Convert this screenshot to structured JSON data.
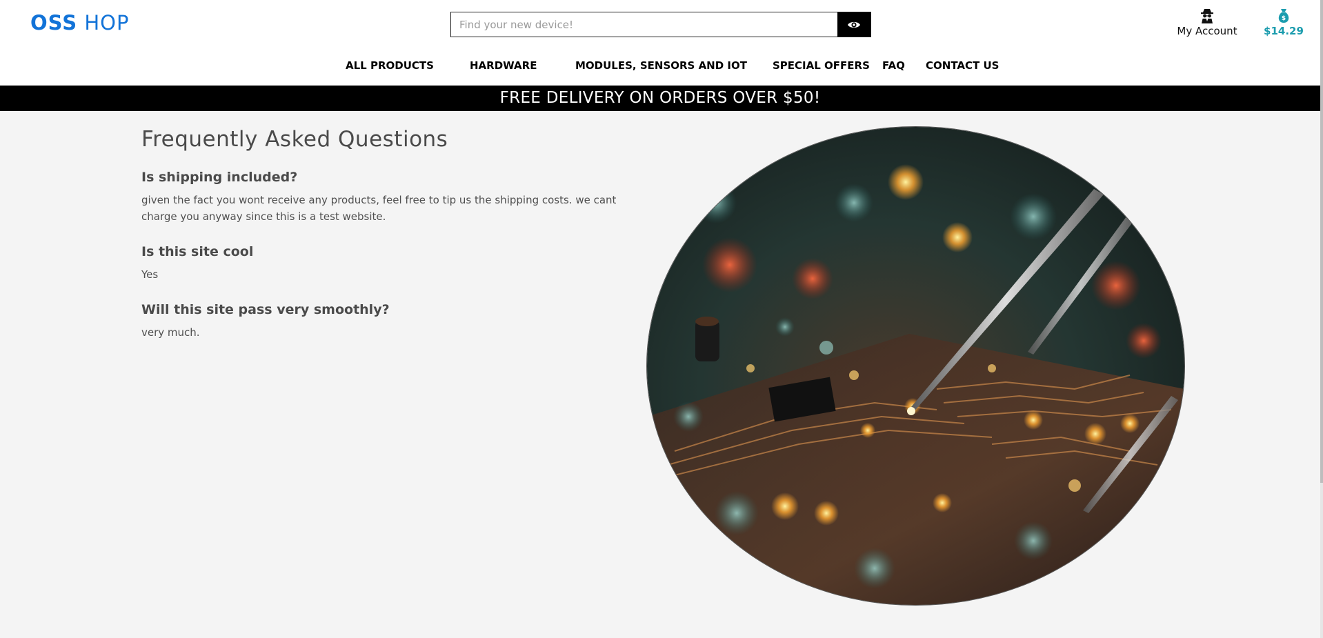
{
  "header": {
    "logo_bold": "OSS",
    "logo_rest": " HOP",
    "search_placeholder": "Find your new device!",
    "search_icon": "eye-icon",
    "account_label": "My Account",
    "account_icon": "spy-icon",
    "cart_total": "$14.29",
    "cart_icon": "money-bag-icon"
  },
  "nav": {
    "items": [
      {
        "label": "ALL PRODUCTS"
      },
      {
        "label": "HARDWARE"
      },
      {
        "label": "MODULES, SENSORS AND IOT"
      },
      {
        "label": "SPECIAL OFFERS"
      },
      {
        "label": "FAQ"
      },
      {
        "label": "CONTACT US"
      }
    ]
  },
  "banner": {
    "text": "FREE DELIVERY ON ORDERS OVER $50!"
  },
  "faq": {
    "title": "Frequently Asked Questions",
    "items": [
      {
        "question": "Is shipping included?",
        "answer": "given the fact you wont receive any products, feel free to tip us the shipping costs. we cant charge you anyway since this is a test website."
      },
      {
        "question": "Is this site cool",
        "answer": "Yes"
      },
      {
        "question": "Will this site pass very smoothly?",
        "answer": "very much."
      }
    ]
  },
  "hero_image": {
    "subject": "circuit-board-closeup-image"
  },
  "colors": {
    "brand": "#1273d8",
    "cart_accent": "#1b9cae",
    "banner_bg": "#000000",
    "page_bg": "#f4f4f4"
  }
}
